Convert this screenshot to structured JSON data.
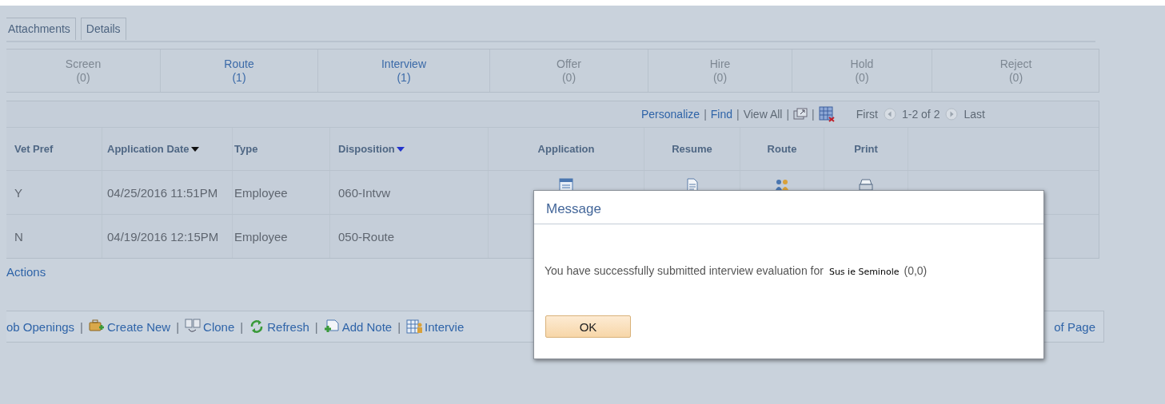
{
  "tabs": [
    {
      "label": "Attachments",
      "selected": false
    },
    {
      "label": "Details",
      "selected": false
    }
  ],
  "pipeline": [
    {
      "label": "Screen",
      "count": "(0)",
      "link": false
    },
    {
      "label": "Route",
      "count": "(1)",
      "link": true
    },
    {
      "label": "Interview",
      "count": "(1)",
      "link": true
    },
    {
      "label": "Offer",
      "count": "(0)",
      "link": false
    },
    {
      "label": "Hire",
      "count": "(0)",
      "link": false
    },
    {
      "label": "Hold",
      "count": "(0)",
      "link": false
    },
    {
      "label": "Reject",
      "count": "(0)",
      "link": false
    }
  ],
  "grid_toolbar": {
    "items": [
      {
        "kind": "link",
        "text": "Personalize"
      },
      {
        "kind": "separator",
        "text": "|"
      },
      {
        "kind": "link",
        "text": "Find"
      },
      {
        "kind": "separator",
        "text": "|"
      },
      {
        "kind": "plain",
        "text": "View All"
      },
      {
        "kind": "separator",
        "text": "|"
      },
      {
        "kind": "zoom"
      },
      {
        "kind": "separator",
        "text": "|"
      },
      {
        "kind": "download"
      }
    ],
    "first": "First",
    "range": "1-2 of 2",
    "last": "Last"
  },
  "table": {
    "columns": [
      {
        "label": "Vet Pref",
        "sorted": false
      },
      {
        "label": "Application Date",
        "sorted": true,
        "color": "#111111"
      },
      {
        "label": "Type",
        "sorted": false
      },
      {
        "label": "Disposition",
        "sorted": true,
        "color": "#2233cc"
      },
      {
        "label": "Application",
        "sorted": false
      },
      {
        "label": "Resume",
        "sorted": false
      },
      {
        "label": "Route",
        "sorted": false
      },
      {
        "label": "Print",
        "sorted": false
      }
    ],
    "rows": [
      {
        "cells": [
          "Y",
          "04/25/2016 11:51PM",
          "Employee",
          "060-Intvw"
        ],
        "actions_visible": true
      },
      {
        "cells": [
          "N",
          "04/19/2016 12:15PM",
          "Employee",
          "050-Route"
        ],
        "actions_visible": false
      }
    ]
  },
  "actions_link": "Actions",
  "bottom_toolbar": {
    "items": [
      {
        "kind": "link",
        "text": "ob Openings"
      },
      {
        "kind": "separator",
        "text": "|"
      },
      {
        "kind": "link",
        "text": "Create New"
      },
      {
        "kind": "separator",
        "text": "|"
      },
      {
        "kind": "link",
        "text": "Clone"
      },
      {
        "kind": "separator",
        "text": "|"
      },
      {
        "kind": "link",
        "text": "Refresh"
      },
      {
        "kind": "separator",
        "text": "|"
      },
      {
        "kind": "link",
        "text": "Add Note"
      },
      {
        "kind": "separator",
        "text": "|"
      },
      {
        "kind": "link",
        "text": "Intervie"
      }
    ],
    "end_link": "of Page"
  },
  "dialog": {
    "title": "Message",
    "text": "You have successfully submitted interview evaluation for",
    "person": "Sus ie Seminole",
    "suffix": "(0,0)",
    "button": "OK"
  }
}
